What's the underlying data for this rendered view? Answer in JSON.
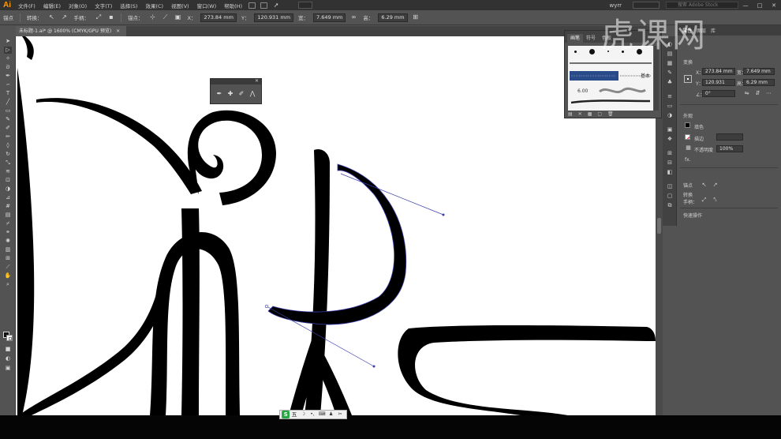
{
  "app": {
    "logo": "Ai",
    "menu": [
      "文件(F)",
      "编辑(E)",
      "对象(O)",
      "文字(T)",
      "选择(S)",
      "效果(C)",
      "视图(V)",
      "窗口(W)",
      "帮助(H)"
    ],
    "user": "wyrr",
    "search_placeholder": "搜索 Adobe Stock",
    "win_minimize": "—",
    "win_maximize": "□",
    "win_close": "✕"
  },
  "controlbar": {
    "selection_label": "锚点",
    "convert_label": "转换：",
    "handles_label": "手柄：",
    "anchor_label": "锚点：",
    "x_label": "X：",
    "x_value": "273.84 mm",
    "y_label": "Y：",
    "y_value": "120.931 mm",
    "w_label": "宽：",
    "w_value": "7.649 mm",
    "h_label": "高：",
    "h_value": "6.29 mm"
  },
  "document": {
    "tab_title": "未标题-1.ai* @ 1600% (CMYK/GPU 预览)",
    "tab_close": "✕"
  },
  "brush_panel": {
    "tabs": [
      "画笔",
      "符号",
      "色板"
    ],
    "brush_label": "基本",
    "brush_size": "6.00"
  },
  "properties": {
    "tabs": [
      "属性",
      "图层",
      "库"
    ],
    "section_transform": "变换",
    "x_label": "X：",
    "x_value": "273.84 mm",
    "y_label": "Y：",
    "y_value": "120.931",
    "w_label": "宽：",
    "w_value": "7.649 mm",
    "h_label": "高：",
    "h_value": "6.29 mm",
    "angle_label": "∠：",
    "angle_value": "0°",
    "section_appearance": "外观",
    "fill_label": "填色",
    "stroke_label": "描边",
    "opacity_label": "不透明度",
    "opacity_value": "100%",
    "fx_label": "fx.",
    "section_anchor": "锚点",
    "convert_label": "转换",
    "handles_label": "手柄：",
    "quick_actions": "快速操作"
  },
  "ime": {
    "logo": "S",
    "mode": "五"
  },
  "watermark": "虎课网",
  "colors": {
    "canvas": "#ffffff",
    "stroke_art": "#000000",
    "selection_path": "#3b3fa8",
    "ui_bg": "#535353"
  }
}
